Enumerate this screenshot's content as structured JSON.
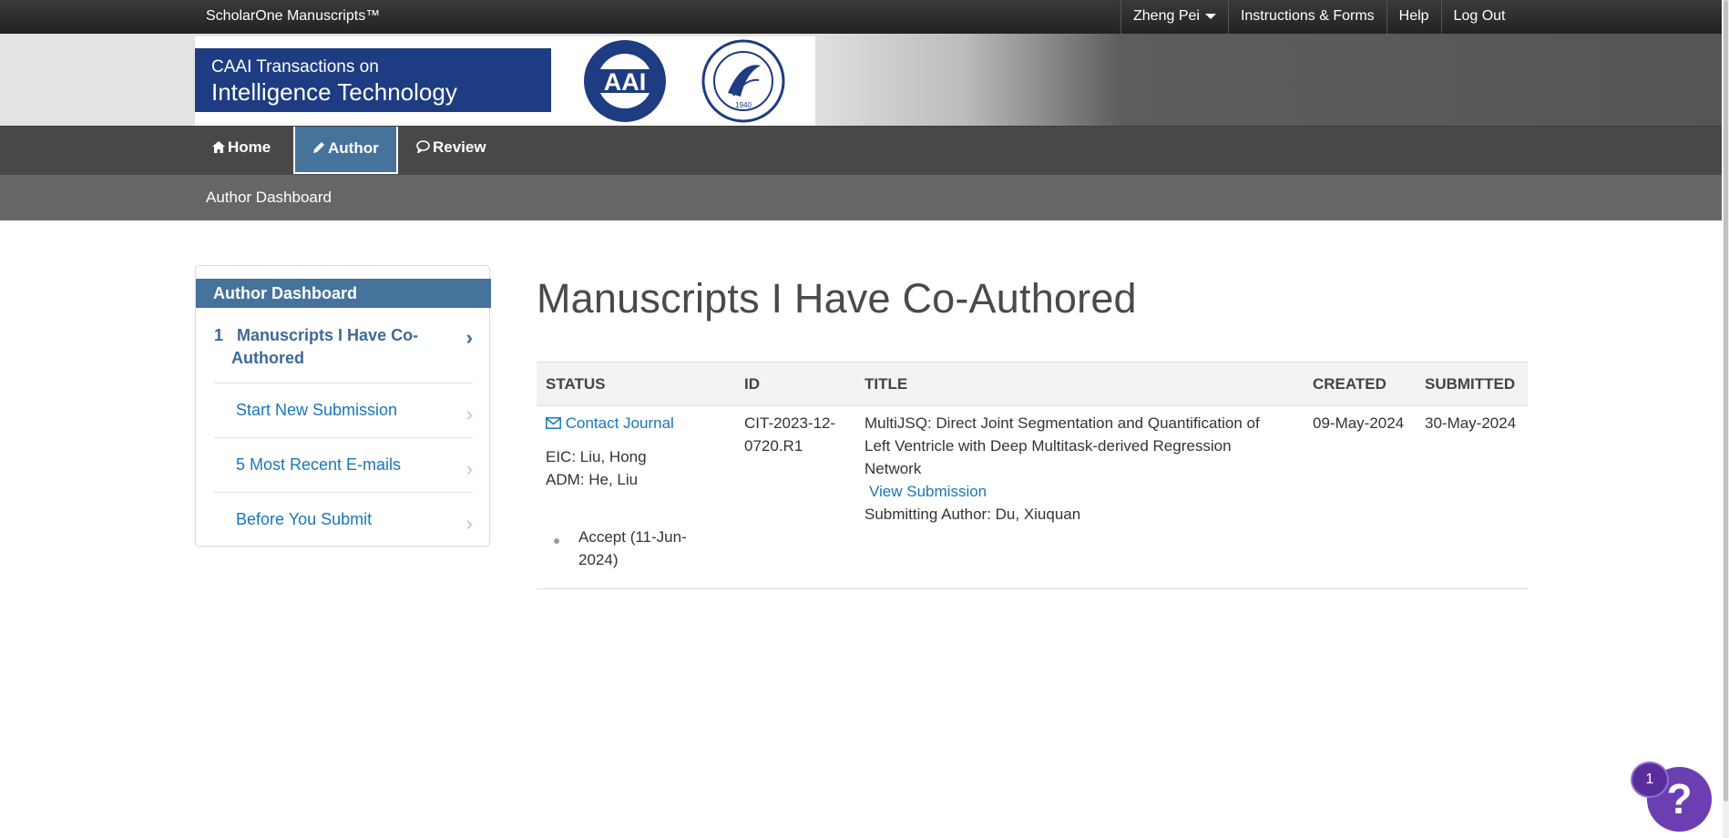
{
  "topbar": {
    "brand": "ScholarOne Manuscripts™",
    "user_menu": "Zheng Pei",
    "instructions": "Instructions & Forms",
    "help": "Help",
    "logout": "Log Out"
  },
  "banner": {
    "journal_line1": "CAAI Transactions on",
    "journal_line2": "Intelligence Technology",
    "aai_logo_text": "AAI",
    "seal_year": "1940"
  },
  "main_nav": {
    "home": "Home",
    "author": "Author",
    "review": "Review"
  },
  "sub_nav": {
    "label": "Author Dashboard"
  },
  "sidebar": {
    "title": "Author Dashboard",
    "items": [
      {
        "count": "1",
        "label_line1": "Manuscripts I Have Co-",
        "label_line2": "Authored"
      },
      {
        "label": "Start New Submission"
      },
      {
        "label": "5 Most Recent E-mails"
      },
      {
        "label": "Before You Submit"
      }
    ]
  },
  "main": {
    "title": "Manuscripts I Have Co-Authored",
    "columns": [
      "STATUS",
      "ID",
      "TITLE",
      "CREATED",
      "SUBMITTED"
    ],
    "row": {
      "contact": "Contact Journal",
      "eic": "EIC: Liu, Hong",
      "adm": "ADM: He, Liu",
      "decision_line1": "Accept (11-Jun-",
      "decision_line2": "2024)",
      "id_line1": "CIT-2023-12-",
      "id_line2": "0720.R1",
      "title_line1": "MultiJSQ: Direct Joint Segmentation and Quantification of",
      "title_line2": "Left Ventricle with Deep Multitask-derived Regression",
      "title_line3": "Network",
      "view_link": "View Submission",
      "submitting_author": "Submitting Author: Du, Xiuquan",
      "created": "09-May-2024",
      "submitted": "30-May-2024"
    }
  },
  "help_widget": {
    "symbol": "?",
    "badge": "1"
  },
  "colors": {
    "nav_active": "#46739c",
    "link": "#1a75b8",
    "journal_blue": "#1d3c81",
    "help_purple": "#6b3fb1"
  },
  "icons": [
    "home-icon",
    "pencil-icon",
    "comment-icon",
    "envelope-icon",
    "chevron-right-icon",
    "caret-down-icon"
  ]
}
